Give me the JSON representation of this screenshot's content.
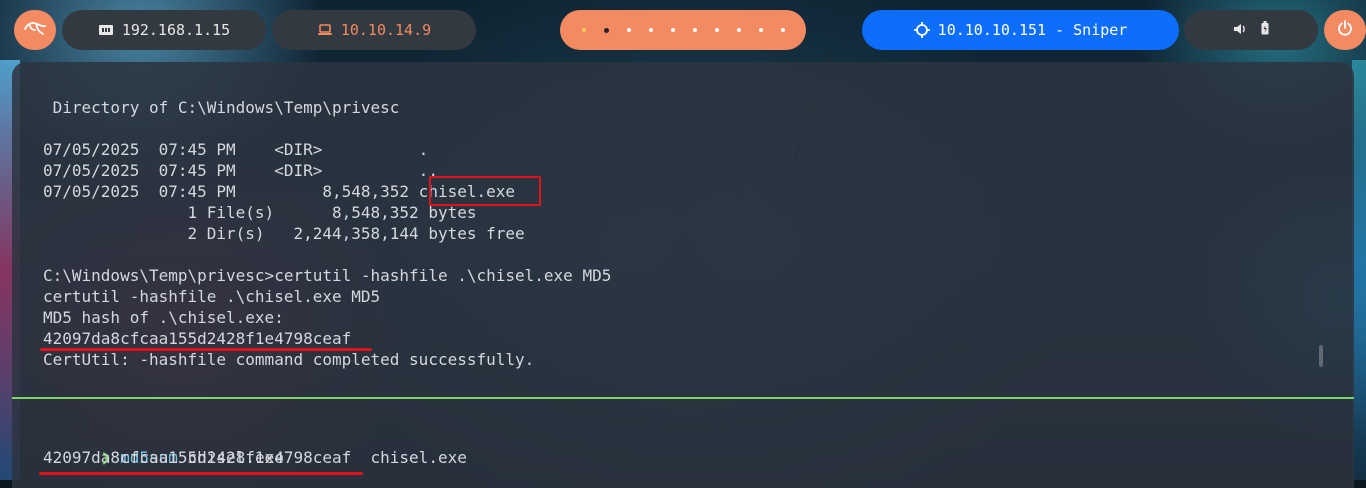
{
  "topbar": {
    "host_ip": "192.168.1.15",
    "vpn_ip": "10.10.14.9",
    "target": "10.10.10.151 - Sniper",
    "workspaces": [
      {
        "active": false,
        "first": true
      },
      {
        "active": true
      },
      {
        "active": false
      },
      {
        "active": false
      },
      {
        "active": false
      },
      {
        "active": false
      },
      {
        "active": false
      },
      {
        "active": false
      },
      {
        "active": false
      },
      {
        "active": false
      }
    ],
    "icons": {
      "launcher": "kali-dragon-icon",
      "host": "ethernet-icon",
      "vpn": "laptop-icon",
      "target": "crosshair-icon",
      "volume": "volume-icon",
      "battery": "battery-icon",
      "power": "power-icon"
    }
  },
  "terminal": {
    "top_lines": [
      " Directory of C:\\Windows\\Temp\\privesc",
      "",
      "07/05/2025  07:45 PM    <DIR>          .",
      "07/05/2025  07:45 PM    <DIR>          ..",
      "07/05/2025  07:45 PM         8,548,352 chisel.exe",
      "               1 File(s)      8,548,352 bytes",
      "               2 Dir(s)   2,244,358,144 bytes free",
      "",
      "C:\\Windows\\Temp\\privesc>certutil -hashfile .\\chisel.exe MD5",
      "certutil -hashfile .\\chisel.exe MD5",
      "MD5 hash of .\\chisel.exe:",
      "42097da8cfcaa155d2428f1e4798ceaf",
      "CertUtil: -hashfile command completed successfully."
    ],
    "bottom": {
      "prompt": "❯",
      "command": "md5sum",
      "argument": "chisel.exe",
      "output": "42097da8cfcaa155d2428f1e4798ceaf  chisel.exe"
    }
  },
  "colors": {
    "accent_orange": "#f48a62",
    "target_blue": "#0d6efd",
    "highlight_red": "#e0121c",
    "divider_green": "#7bd36a"
  }
}
